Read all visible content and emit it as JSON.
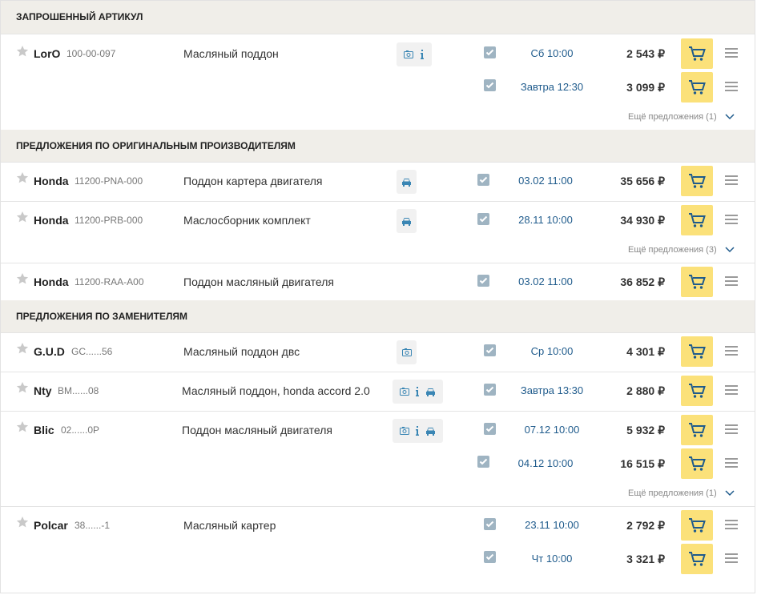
{
  "sections": {
    "requested": "ЗАПРОШЕННЫЙ АРТИКУЛ",
    "original": "ПРЕДЛОЖЕНИЯ ПО ОРИГИНАЛЬНЫМ ПРОИЗВОДИТЕЛЯМ",
    "substitutes": "ПРЕДЛОЖЕНИЯ ПО ЗАМЕНИТЕЛЯМ"
  },
  "products": [
    {
      "brand": "LorO",
      "code": "100-00-097",
      "desc": "Масляный поддон",
      "icons": [
        "photo-icon",
        "info-icon"
      ],
      "offers": [
        {
          "date": "Сб 10:00",
          "price": "2 543 ₽"
        },
        {
          "date": "Завтра 12:30",
          "price": "3 099 ₽"
        }
      ],
      "more": "Ещё предложения (1)"
    },
    {
      "brand": "Honda",
      "code": "11200-PNA-000",
      "desc": "Поддон картера двигателя",
      "icons": [
        "car-icon"
      ],
      "offers": [
        {
          "date": "03.02 11:00",
          "price": "35 656 ₽"
        }
      ]
    },
    {
      "brand": "Honda",
      "code": "11200-PRB-000",
      "desc": "Маслосборник комплект",
      "icons": [
        "car-icon"
      ],
      "offers": [
        {
          "date": "28.11 10:00",
          "price": "34 930 ₽"
        }
      ],
      "more": "Ещё предложения (3)"
    },
    {
      "brand": "Honda",
      "code": "11200-RAA-A00",
      "desc": "Поддон масляный двигателя",
      "icons": [],
      "offers": [
        {
          "date": "03.02 11:00",
          "price": "36 852 ₽"
        }
      ]
    },
    {
      "brand": "G.U.D",
      "code": "GC......56",
      "desc": "Масляный поддон двс",
      "icons": [
        "photo-icon"
      ],
      "offers": [
        {
          "date": "Ср 10:00",
          "price": "4 301 ₽"
        }
      ]
    },
    {
      "brand": "Nty",
      "code": "BM......08",
      "desc": "Масляный поддон, honda accord 2.0",
      "icons": [
        "photo-icon",
        "info-icon",
        "car-icon"
      ],
      "offers": [
        {
          "date": "Завтра 13:30",
          "price": "2 880 ₽"
        }
      ]
    },
    {
      "brand": "Blic",
      "code": "02......0P",
      "desc": "Поддон масляный двигателя",
      "icons": [
        "photo-icon",
        "info-icon",
        "car-icon"
      ],
      "offers": [
        {
          "date": "07.12 10:00",
          "price": "5 932 ₽"
        },
        {
          "date": "04.12 10:00",
          "price": "16 515 ₽"
        }
      ],
      "more": "Ещё предложения (1)"
    },
    {
      "brand": "Polcar",
      "code": "38......-1",
      "desc": "Масляный картер",
      "icons": [],
      "offers": [
        {
          "date": "23.11 10:00",
          "price": "2 792 ₽"
        },
        {
          "date": "Чт 10:00",
          "price": "3 321 ₽"
        }
      ]
    }
  ],
  "colors": {
    "accent": "#fbe17a",
    "link": "#1f5b8c",
    "header_bg": "#f0eee9",
    "checkbox": "#9fb4c2"
  }
}
